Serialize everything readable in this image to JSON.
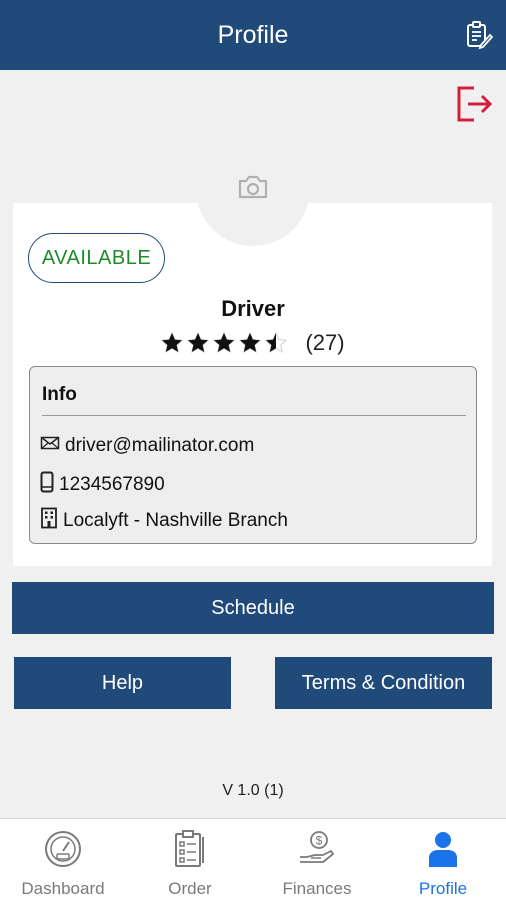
{
  "header": {
    "title": "Profile",
    "action_icon": "clipboard-edit-icon"
  },
  "logout": {
    "icon": "logout-icon",
    "color": "#d0213a"
  },
  "profile": {
    "avatar_icon": "camera-icon",
    "status": "AVAILABLE",
    "name": "Driver",
    "rating": 4.5,
    "rating_count": "(27)"
  },
  "info": {
    "title": "Info",
    "email": "driver@mailinator.com",
    "phone": "1234567890",
    "branch": "Localyft - Nashville Branch"
  },
  "buttons": {
    "schedule": "Schedule",
    "help": "Help",
    "terms": "Terms & Condition"
  },
  "version": "V 1.0 (1)",
  "tabs": [
    {
      "label": "Dashboard",
      "icon": "speedometer-icon",
      "active": false
    },
    {
      "label": "Order",
      "icon": "clipboard-list-icon",
      "active": false
    },
    {
      "label": "Finances",
      "icon": "hand-money-icon",
      "active": false
    },
    {
      "label": "Profile",
      "icon": "user-icon",
      "active": true
    }
  ],
  "colors": {
    "primary": "#204a7a",
    "available": "#1f8a2a",
    "active_tab": "#1a73e8",
    "logout": "#d0213a"
  }
}
